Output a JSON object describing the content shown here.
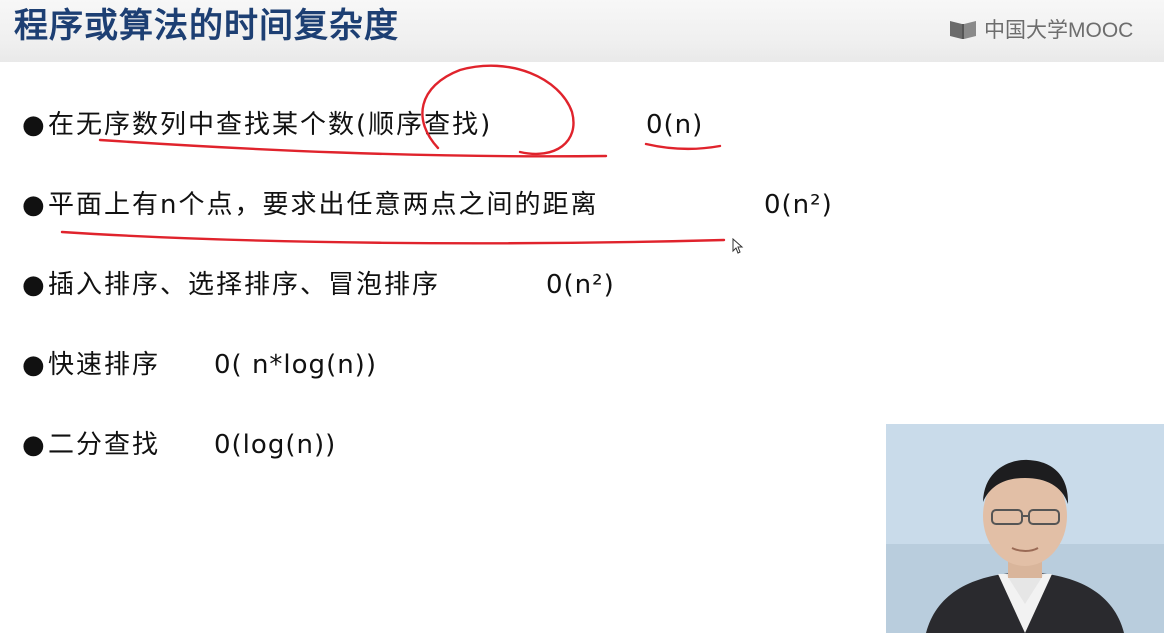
{
  "header": {
    "title": "程序或算法的时间复杂度",
    "logo_text": "中国大学MOOC",
    "logo_icon": "mooc-book-icon"
  },
  "slide": {
    "bullet_symbol": "●",
    "items": [
      {
        "text": "在无序数列中查找某个数(顺序查找)",
        "complexity": "0(n)"
      },
      {
        "text": "平面上有n个点，要求出任意两点之间的距离",
        "complexity": "0(n²)"
      },
      {
        "text": "插入排序、选择排序、冒泡排序",
        "complexity": "0(n²)"
      },
      {
        "text": "快速排序",
        "complexity": "0( n*log(n))"
      },
      {
        "text": "二分查找",
        "complexity": "0(log(n))"
      }
    ]
  },
  "colors": {
    "title": "#1d3f73",
    "annotation_ink": "#e0232c",
    "text": "#111111"
  }
}
